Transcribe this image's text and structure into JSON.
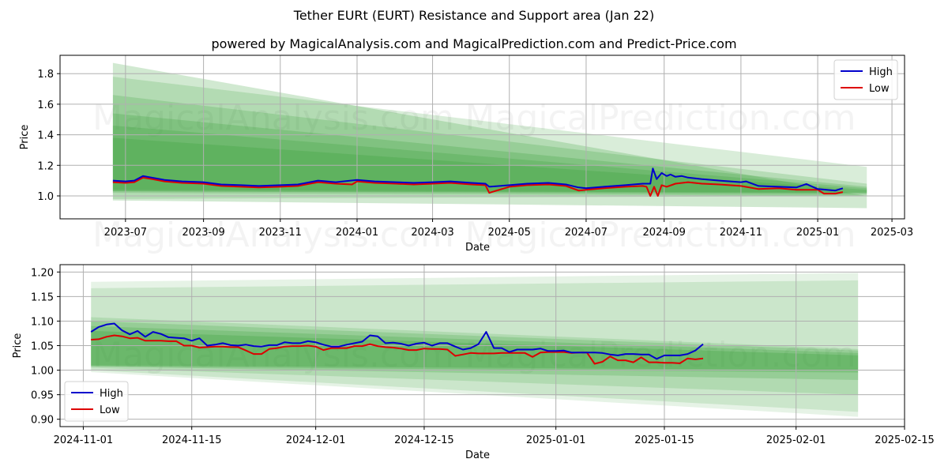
{
  "header": {
    "title": "Tether EURt (EURT) Resistance and Support area (Jan 22)",
    "subtitle": "powered by MagicalAnalysis.com and MagicalPrediction.com and Predict-Price.com"
  },
  "watermarks": [
    "MagicalAnalysis.com",
    "MagicalPrediction.com"
  ],
  "colors": {
    "high": "#0000cc",
    "low": "#dd0000",
    "band": "#2e9a2e"
  },
  "chart_data": [
    {
      "type": "line",
      "title": "",
      "xlabel": "Date",
      "ylabel": "Price",
      "ylim": [
        0.85,
        1.92
      ],
      "xlim": [
        "2023-05-10",
        "2025-03-11"
      ],
      "grid": true,
      "legend_position": "top-right",
      "legend": [
        "High",
        "Low"
      ],
      "yticks": [
        "1.0",
        "1.2",
        "1.4",
        "1.6",
        "1.8"
      ],
      "xticks": [
        "2023-07",
        "2023-09",
        "2023-11",
        "2024-01",
        "2024-03",
        "2024-05",
        "2024-07",
        "2024-09",
        "2024-11",
        "2025-01",
        "2025-03"
      ],
      "bands": {
        "start_date": "2023-06-21",
        "end_date": "2025-02-09",
        "layers": [
          {
            "upper": [
              1.87,
              1.0
            ],
            "lower": [
              0.97,
              0.92
            ],
            "opacity": 0.22
          },
          {
            "upper": [
              1.78,
              1.19
            ],
            "lower": [
              0.98,
              1.0
            ],
            "opacity": 0.18
          },
          {
            "upper": [
              1.66,
              1.08
            ],
            "lower": [
              1.02,
              1.0
            ],
            "opacity": 0.2
          },
          {
            "upper": [
              1.54,
              1.06
            ],
            "lower": [
              1.03,
              1.01
            ],
            "opacity": 0.22
          },
          {
            "upper": [
              1.46,
              1.05
            ],
            "lower": [
              1.03,
              1.02
            ],
            "opacity": 0.22
          },
          {
            "upper": [
              1.38,
              1.04
            ],
            "lower": [
              1.04,
              1.02
            ],
            "opacity": 0.22
          }
        ]
      },
      "series": [
        {
          "name": "High",
          "x": [
            "2023-06-21",
            "2023-07-01",
            "2023-07-08",
            "2023-07-15",
            "2023-07-22",
            "2023-08-01",
            "2023-08-15",
            "2023-09-01",
            "2023-09-15",
            "2023-10-01",
            "2023-10-15",
            "2023-11-01",
            "2023-11-15",
            "2023-12-01",
            "2023-12-15",
            "2024-01-01",
            "2024-01-15",
            "2024-02-01",
            "2024-02-15",
            "2024-03-01",
            "2024-03-15",
            "2024-04-01",
            "2024-04-12",
            "2024-04-15",
            "2024-05-01",
            "2024-05-15",
            "2024-06-01",
            "2024-06-15",
            "2024-06-25",
            "2024-07-01",
            "2024-07-15",
            "2024-08-01",
            "2024-08-15",
            "2024-08-21",
            "2024-08-23",
            "2024-08-26",
            "2024-08-30",
            "2024-09-03",
            "2024-09-06",
            "2024-09-10",
            "2024-09-15",
            "2024-09-20",
            "2024-10-01",
            "2024-10-15",
            "2024-11-01",
            "2024-11-05",
            "2024-11-15",
            "2024-12-01",
            "2024-12-15",
            "2024-12-23",
            "2025-01-01",
            "2025-01-15",
            "2025-01-21"
          ],
          "values": [
            1.1,
            1.095,
            1.1,
            1.13,
            1.12,
            1.105,
            1.095,
            1.09,
            1.075,
            1.07,
            1.065,
            1.07,
            1.075,
            1.1,
            1.09,
            1.105,
            1.095,
            1.09,
            1.085,
            1.09,
            1.095,
            1.085,
            1.08,
            1.06,
            1.07,
            1.08,
            1.085,
            1.075,
            1.055,
            1.05,
            1.06,
            1.07,
            1.08,
            1.08,
            1.18,
            1.11,
            1.15,
            1.13,
            1.14,
            1.125,
            1.13,
            1.12,
            1.11,
            1.1,
            1.09,
            1.095,
            1.065,
            1.06,
            1.055,
            1.078,
            1.045,
            1.035,
            1.05
          ]
        },
        {
          "name": "Low",
          "x": [
            "2023-06-21",
            "2023-07-01",
            "2023-07-08",
            "2023-07-15",
            "2023-07-22",
            "2023-08-01",
            "2023-08-15",
            "2023-09-01",
            "2023-09-15",
            "2023-10-01",
            "2023-10-15",
            "2023-11-01",
            "2023-11-15",
            "2023-12-01",
            "2023-12-15",
            "2023-12-28",
            "2024-01-01",
            "2024-01-15",
            "2024-02-01",
            "2024-02-15",
            "2024-03-01",
            "2024-03-15",
            "2024-04-01",
            "2024-04-12",
            "2024-04-15",
            "2024-05-01",
            "2024-05-15",
            "2024-06-01",
            "2024-06-15",
            "2024-06-25",
            "2024-07-01",
            "2024-07-15",
            "2024-08-01",
            "2024-08-15",
            "2024-08-18",
            "2024-08-21",
            "2024-08-24",
            "2024-08-27",
            "2024-08-30",
            "2024-09-03",
            "2024-09-10",
            "2024-09-20",
            "2024-10-01",
            "2024-10-15",
            "2024-11-01",
            "2024-11-15",
            "2024-12-01",
            "2024-12-15",
            "2025-01-01",
            "2025-01-06",
            "2025-01-15",
            "2025-01-21"
          ],
          "values": [
            1.09,
            1.085,
            1.09,
            1.12,
            1.11,
            1.095,
            1.085,
            1.08,
            1.065,
            1.06,
            1.055,
            1.06,
            1.065,
            1.09,
            1.08,
            1.075,
            1.095,
            1.085,
            1.08,
            1.075,
            1.08,
            1.085,
            1.075,
            1.07,
            1.02,
            1.06,
            1.07,
            1.075,
            1.065,
            1.035,
            1.04,
            1.05,
            1.06,
            1.065,
            1.06,
            1.0,
            1.06,
            1.0,
            1.07,
            1.06,
            1.08,
            1.09,
            1.08,
            1.075,
            1.065,
            1.045,
            1.05,
            1.04,
            1.04,
            1.015,
            1.015,
            1.025
          ]
        }
      ]
    },
    {
      "type": "line",
      "title": "",
      "xlabel": "Date",
      "ylabel": "Price",
      "ylim": [
        0.885,
        1.215
      ],
      "xlim": [
        "2024-10-29",
        "2025-02-15"
      ],
      "grid": true,
      "legend_position": "lower-left",
      "legend": [
        "High",
        "Low"
      ],
      "yticks": [
        "0.90",
        "0.95",
        "1.00",
        "1.05",
        "1.10",
        "1.15",
        "1.20"
      ],
      "xticks": [
        "2024-11-01",
        "2024-11-15",
        "2024-12-01",
        "2024-12-15",
        "2025-01-01",
        "2025-01-15",
        "2025-02-01",
        "2025-02-15"
      ],
      "bands": {
        "start_date": "2024-11-02",
        "end_date": "2025-02-09",
        "layers": [
          {
            "upper": [
              1.18,
              1.198
            ],
            "lower": [
              0.996,
              0.905
            ],
            "opacity": 0.12
          },
          {
            "upper": [
              1.167,
              1.183
            ],
            "lower": [
              1.0,
              0.915
            ],
            "opacity": 0.14
          },
          {
            "upper": [
              1.108,
              1.043
            ],
            "lower": [
              1.005,
              0.95
            ],
            "opacity": 0.16
          },
          {
            "upper": [
              1.1,
              1.04
            ],
            "lower": [
              1.008,
              0.98
            ],
            "opacity": 0.2
          },
          {
            "upper": [
              1.09,
              1.035
            ],
            "lower": [
              1.008,
              0.995
            ],
            "opacity": 0.22
          },
          {
            "upper": [
              1.08,
              1.03
            ],
            "lower": [
              1.01,
              1.0
            ],
            "opacity": 0.25
          }
        ]
      },
      "series": [
        {
          "name": "High",
          "x": [
            "2024-11-02",
            "2024-11-03",
            "2024-11-04",
            "2024-11-05",
            "2024-11-06",
            "2024-11-07",
            "2024-11-08",
            "2024-11-09",
            "2024-11-10",
            "2024-11-11",
            "2024-11-12",
            "2024-11-13",
            "2024-11-14",
            "2024-11-15",
            "2024-11-16",
            "2024-11-17",
            "2024-11-18",
            "2024-11-19",
            "2024-11-20",
            "2024-11-21",
            "2024-11-22",
            "2024-11-23",
            "2024-11-24",
            "2024-11-25",
            "2024-11-26",
            "2024-11-27",
            "2024-11-28",
            "2024-11-29",
            "2024-11-30",
            "2024-12-01",
            "2024-12-02",
            "2024-12-03",
            "2024-12-04",
            "2024-12-05",
            "2024-12-06",
            "2024-12-07",
            "2024-12-08",
            "2024-12-09",
            "2024-12-10",
            "2024-12-11",
            "2024-12-12",
            "2024-12-13",
            "2024-12-14",
            "2024-12-15",
            "2024-12-16",
            "2024-12-17",
            "2024-12-18",
            "2024-12-19",
            "2024-12-20",
            "2024-12-21",
            "2024-12-22",
            "2024-12-23",
            "2024-12-24",
            "2024-12-25",
            "2024-12-26",
            "2024-12-27",
            "2024-12-28",
            "2024-12-29",
            "2024-12-30",
            "2024-12-31",
            "2025-01-01",
            "2025-01-02",
            "2025-01-03",
            "2025-01-04",
            "2025-01-05",
            "2025-01-06",
            "2025-01-07",
            "2025-01-08",
            "2025-01-09",
            "2025-01-10",
            "2025-01-11",
            "2025-01-12",
            "2025-01-13",
            "2025-01-14",
            "2025-01-15",
            "2025-01-16",
            "2025-01-17",
            "2025-01-18",
            "2025-01-19",
            "2025-01-20"
          ],
          "values": [
            1.078,
            1.088,
            1.093,
            1.095,
            1.081,
            1.073,
            1.08,
            1.068,
            1.078,
            1.074,
            1.067,
            1.066,
            1.065,
            1.06,
            1.065,
            1.05,
            1.052,
            1.055,
            1.051,
            1.05,
            1.052,
            1.049,
            1.048,
            1.051,
            1.051,
            1.057,
            1.055,
            1.055,
            1.059,
            1.057,
            1.052,
            1.048,
            1.048,
            1.052,
            1.055,
            1.058,
            1.071,
            1.069,
            1.055,
            1.056,
            1.054,
            1.05,
            1.054,
            1.056,
            1.05,
            1.055,
            1.055,
            1.048,
            1.042,
            1.045,
            1.053,
            1.078,
            1.045,
            1.045,
            1.037,
            1.042,
            1.042,
            1.042,
            1.044,
            1.039,
            1.039,
            1.04,
            1.036,
            1.036,
            1.036,
            1.036,
            1.035,
            1.032,
            1.03,
            1.033,
            1.033,
            1.032,
            1.032,
            1.023,
            1.03,
            1.03,
            1.03,
            1.033,
            1.04,
            1.053
          ]
        },
        {
          "name": "Low",
          "x": [
            "2024-11-02",
            "2024-11-03",
            "2024-11-04",
            "2024-11-05",
            "2024-11-06",
            "2024-11-07",
            "2024-11-08",
            "2024-11-09",
            "2024-11-10",
            "2024-11-11",
            "2024-11-12",
            "2024-11-13",
            "2024-11-14",
            "2024-11-15",
            "2024-11-16",
            "2024-11-17",
            "2024-11-18",
            "2024-11-19",
            "2024-11-20",
            "2024-11-21",
            "2024-11-22",
            "2024-11-23",
            "2024-11-24",
            "2024-11-25",
            "2024-11-26",
            "2024-11-27",
            "2024-11-28",
            "2024-11-29",
            "2024-11-30",
            "2024-12-01",
            "2024-12-02",
            "2024-12-03",
            "2024-12-04",
            "2024-12-05",
            "2024-12-06",
            "2024-12-07",
            "2024-12-08",
            "2024-12-09",
            "2024-12-10",
            "2024-12-11",
            "2024-12-12",
            "2024-12-13",
            "2024-12-14",
            "2024-12-15",
            "2024-12-16",
            "2024-12-17",
            "2024-12-18",
            "2024-12-19",
            "2024-12-20",
            "2024-12-21",
            "2024-12-22",
            "2024-12-23",
            "2024-12-24",
            "2024-12-25",
            "2024-12-26",
            "2024-12-27",
            "2024-12-28",
            "2024-12-29",
            "2024-12-30",
            "2024-12-31",
            "2025-01-01",
            "2025-01-02",
            "2025-01-03",
            "2025-01-04",
            "2025-01-05",
            "2025-01-06",
            "2025-01-07",
            "2025-01-08",
            "2025-01-09",
            "2025-01-10",
            "2025-01-11",
            "2025-01-12",
            "2025-01-13",
            "2025-01-14",
            "2025-01-15",
            "2025-01-16",
            "2025-01-17",
            "2025-01-18",
            "2025-01-19",
            "2025-01-20"
          ],
          "values": [
            1.062,
            1.063,
            1.068,
            1.071,
            1.069,
            1.065,
            1.066,
            1.06,
            1.06,
            1.06,
            1.059,
            1.059,
            1.05,
            1.05,
            1.046,
            1.047,
            1.048,
            1.048,
            1.047,
            1.047,
            1.04,
            1.033,
            1.033,
            1.043,
            1.045,
            1.048,
            1.049,
            1.049,
            1.05,
            1.048,
            1.041,
            1.045,
            1.045,
            1.045,
            1.049,
            1.049,
            1.053,
            1.049,
            1.047,
            1.046,
            1.044,
            1.041,
            1.041,
            1.044,
            1.043,
            1.043,
            1.042,
            1.029,
            1.032,
            1.035,
            1.034,
            1.034,
            1.034,
            1.035,
            1.035,
            1.035,
            1.035,
            1.027,
            1.036,
            1.037,
            1.037,
            1.037,
            1.035,
            1.036,
            1.036,
            1.013,
            1.017,
            1.028,
            1.02,
            1.02,
            1.016,
            1.026,
            1.016,
            1.016,
            1.015,
            1.015,
            1.014,
            1.024,
            1.022,
            1.024
          ]
        }
      ]
    }
  ]
}
